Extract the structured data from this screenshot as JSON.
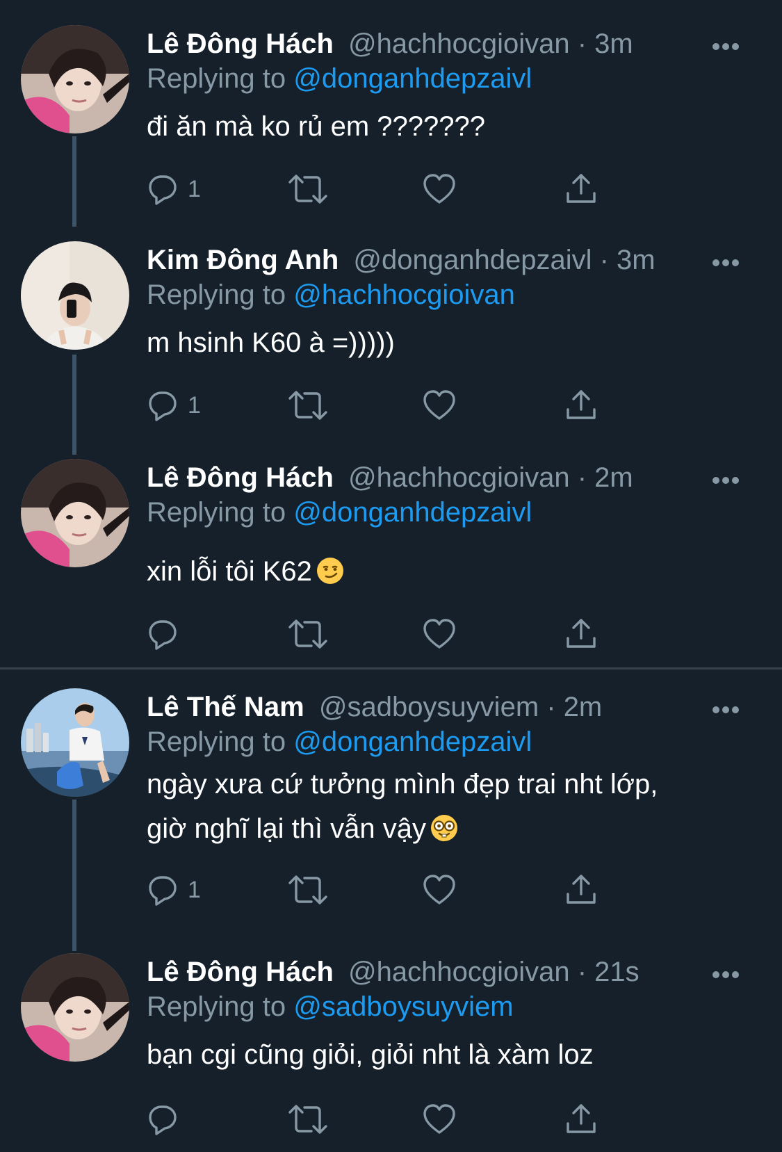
{
  "theme": {
    "background": "#15202b",
    "name_color": "#ffffff",
    "muted_color": "#8899a6",
    "link_color": "#1d9bf0",
    "thread_line_color": "#3d5466",
    "divider_color": "#38444d"
  },
  "tweets": [
    {
      "name": "Lê Đông Hách",
      "handle": "@hachhocgioivan",
      "dot": " · ",
      "time": "3m",
      "replying_prefix": "Replying to ",
      "replying_to": "@donganhdepzaivl",
      "text_lines": [
        "đi ăn mà ko rủ em ???????"
      ],
      "reply_count": "1",
      "avatar": "boy-pink-hoodie-avatar"
    },
    {
      "name": "Kim Đông Anh",
      "handle": "@donganhdepzaivl",
      "dot": " · ",
      "time": "3m",
      "replying_prefix": "Replying to ",
      "replying_to": "@hachhocgioivan",
      "text_lines": [
        "m hsinh K60 à =)))))"
      ],
      "reply_count": "1",
      "avatar": "mirror-selfie-avatar"
    },
    {
      "name": "Lê Đông Hách",
      "handle": "@hachhocgioivan",
      "dot": " · ",
      "time": "2m",
      "replying_prefix": "Replying to ",
      "replying_to": "@donganhdepzaivl",
      "text_lines": [
        "xin lỗi tôi K62"
      ],
      "emoji": "smirk-emoji",
      "reply_count": "",
      "avatar": "boy-pink-hoodie-avatar"
    },
    {
      "name": "Lê Thế Nam",
      "handle": "@sadboysuyviem",
      "dot": " · ",
      "time": "2m",
      "replying_prefix": "Replying to ",
      "replying_to": "@donganhdepzaivl",
      "text_lines": [
        "ngày xưa cứ tưởng mình đẹp trai nht lớp,",
        "giờ nghĩ lại thì vẫn vậy"
      ],
      "emoji": "nerd-emoji",
      "reply_count": "1",
      "avatar": "beach-boat-avatar"
    },
    {
      "name": "Lê Đông Hách",
      "handle": "@hachhocgioivan",
      "dot": " · ",
      "time": "21s",
      "replying_prefix": "Replying to ",
      "replying_to": "@sadboysuyviem",
      "text_lines": [
        "bạn cgi cũng giỏi, giỏi nht là xàm loz"
      ],
      "reply_count": "",
      "avatar": "boy-pink-hoodie-avatar"
    }
  ],
  "icons": {
    "more": "more-horizontal-icon",
    "reply": "reply-bubble-icon",
    "retweet": "retweet-icon",
    "like": "heart-icon",
    "share": "share-icon"
  }
}
